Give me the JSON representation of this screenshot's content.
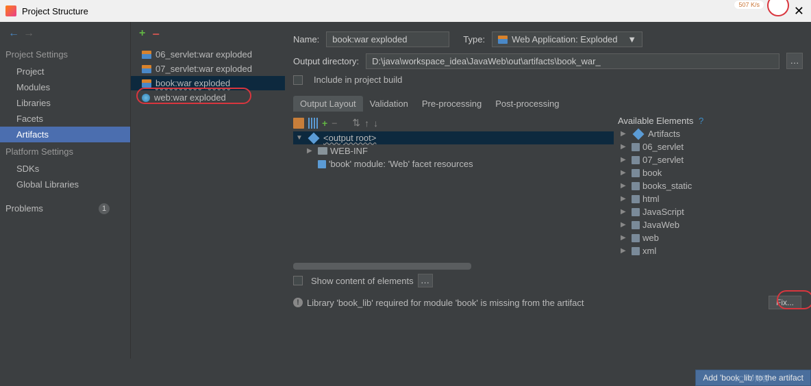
{
  "window": {
    "title": "Project Structure"
  },
  "sidebar": {
    "back_icon": "←",
    "forward_icon": "→",
    "sections": [
      {
        "title": "Project Settings",
        "items": [
          "Project",
          "Modules",
          "Libraries",
          "Facets",
          "Artifacts"
        ]
      },
      {
        "title": "Platform Settings",
        "items": [
          "SDKs",
          "Global Libraries"
        ]
      }
    ],
    "problems_label": "Problems",
    "problems_count": "1",
    "selected": "Artifacts"
  },
  "artifacts": {
    "items": [
      {
        "label": "06_servlet:war exploded",
        "icon": "gift"
      },
      {
        "label": "07_servlet:war exploded",
        "icon": "gift"
      },
      {
        "label": "book:war exploded",
        "icon": "gift",
        "selected": true
      },
      {
        "label": "web:war exploded",
        "icon": "globe"
      }
    ]
  },
  "form": {
    "name_label": "Name:",
    "name_value": "book:war exploded",
    "type_label": "Type:",
    "type_value": "Web Application: Exploded",
    "output_dir_label": "Output directory:",
    "output_dir_value": "D:\\java\\workspace_idea\\JavaWeb\\out\\artifacts\\book_war_",
    "include_build_label": "Include in project build"
  },
  "tabs": {
    "items": [
      "Output Layout",
      "Validation",
      "Pre-processing",
      "Post-processing"
    ],
    "active": 0
  },
  "layout": {
    "available_label": "Available Elements",
    "tree": [
      {
        "label": "<output root>",
        "icon": "diamond",
        "expanded": true,
        "selected": true,
        "indent": 0
      },
      {
        "label": "WEB-INF",
        "icon": "folder",
        "expanded": false,
        "indent": 1
      },
      {
        "label": "'book' module: 'Web' facet resources",
        "icon": "module",
        "leaf": true,
        "indent": 1
      }
    ],
    "available": [
      {
        "label": "Artifacts",
        "icon": "diamond"
      },
      {
        "label": "06_servlet",
        "icon": "module"
      },
      {
        "label": "07_servlet",
        "icon": "module"
      },
      {
        "label": "book",
        "icon": "module"
      },
      {
        "label": "books_static",
        "icon": "module"
      },
      {
        "label": "html",
        "icon": "module"
      },
      {
        "label": "JavaScript",
        "icon": "module"
      },
      {
        "label": "JavaWeb",
        "icon": "module"
      },
      {
        "label": "web",
        "icon": "module"
      },
      {
        "label": "xml",
        "icon": "module"
      }
    ]
  },
  "footer": {
    "show_content_label": "Show content of elements",
    "warning_text": "Library 'book_lib' required for module 'book' is missing from the artifact",
    "fix_label": "Fix...",
    "tooltip_text": "Add 'book_lib' to the artifact",
    "watermark": "1CTO博客"
  },
  "corner": {
    "speed": "507 K/s"
  }
}
